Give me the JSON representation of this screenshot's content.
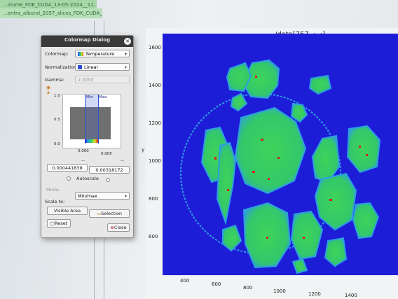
{
  "background": {
    "file_tabs": [
      "...olume_FDK_CUDA_13-05-2024__11...",
      "...entra_albural_2057_slices_FDK_CUDA_13-05-2024__11..."
    ]
  },
  "dialog": {
    "title": "Colormap Dialog",
    "colormap_label": "Colormap:",
    "colormap_value": "Temperature",
    "normalization_label": "Normalization:",
    "normalization_value": "Linear",
    "gamma_label": "Gamma:",
    "gamma_value": "2.0000",
    "histogram": {
      "min_label": "Min",
      "max_label": "Max",
      "y_ticks": [
        "1.0",
        "0.5",
        "0.0"
      ],
      "x_ticks": [
        "0.000",
        "0.005"
      ]
    },
    "min_value": "0.000441838",
    "max_value": "0.00318172",
    "autoscale_label": "Autoscale",
    "mode_label": "Mode:",
    "mode_value": "Min/max",
    "scale_to_label": "Scale to:",
    "visible_area_button": "Visible Area",
    "selection_button": "Selection",
    "reset_button": "Reset",
    "close_button": "Close"
  },
  "plot": {
    "title": "/data[757, :, :]",
    "ylabel": "y",
    "y_ticks": [
      "1600",
      "1400",
      "1200",
      "1000",
      "800",
      "600"
    ],
    "x_ticks": [
      "400",
      "600",
      "800",
      "1000",
      "1200",
      "1400"
    ]
  },
  "colors": {
    "background_blue": "#1d1dd8",
    "region_green": "#33d05b",
    "region_cyan": "#2ea3e0",
    "hot_red": "#d42020",
    "dialog_bg": "#e7e7e7",
    "titlebar": "#3a3a3a"
  }
}
